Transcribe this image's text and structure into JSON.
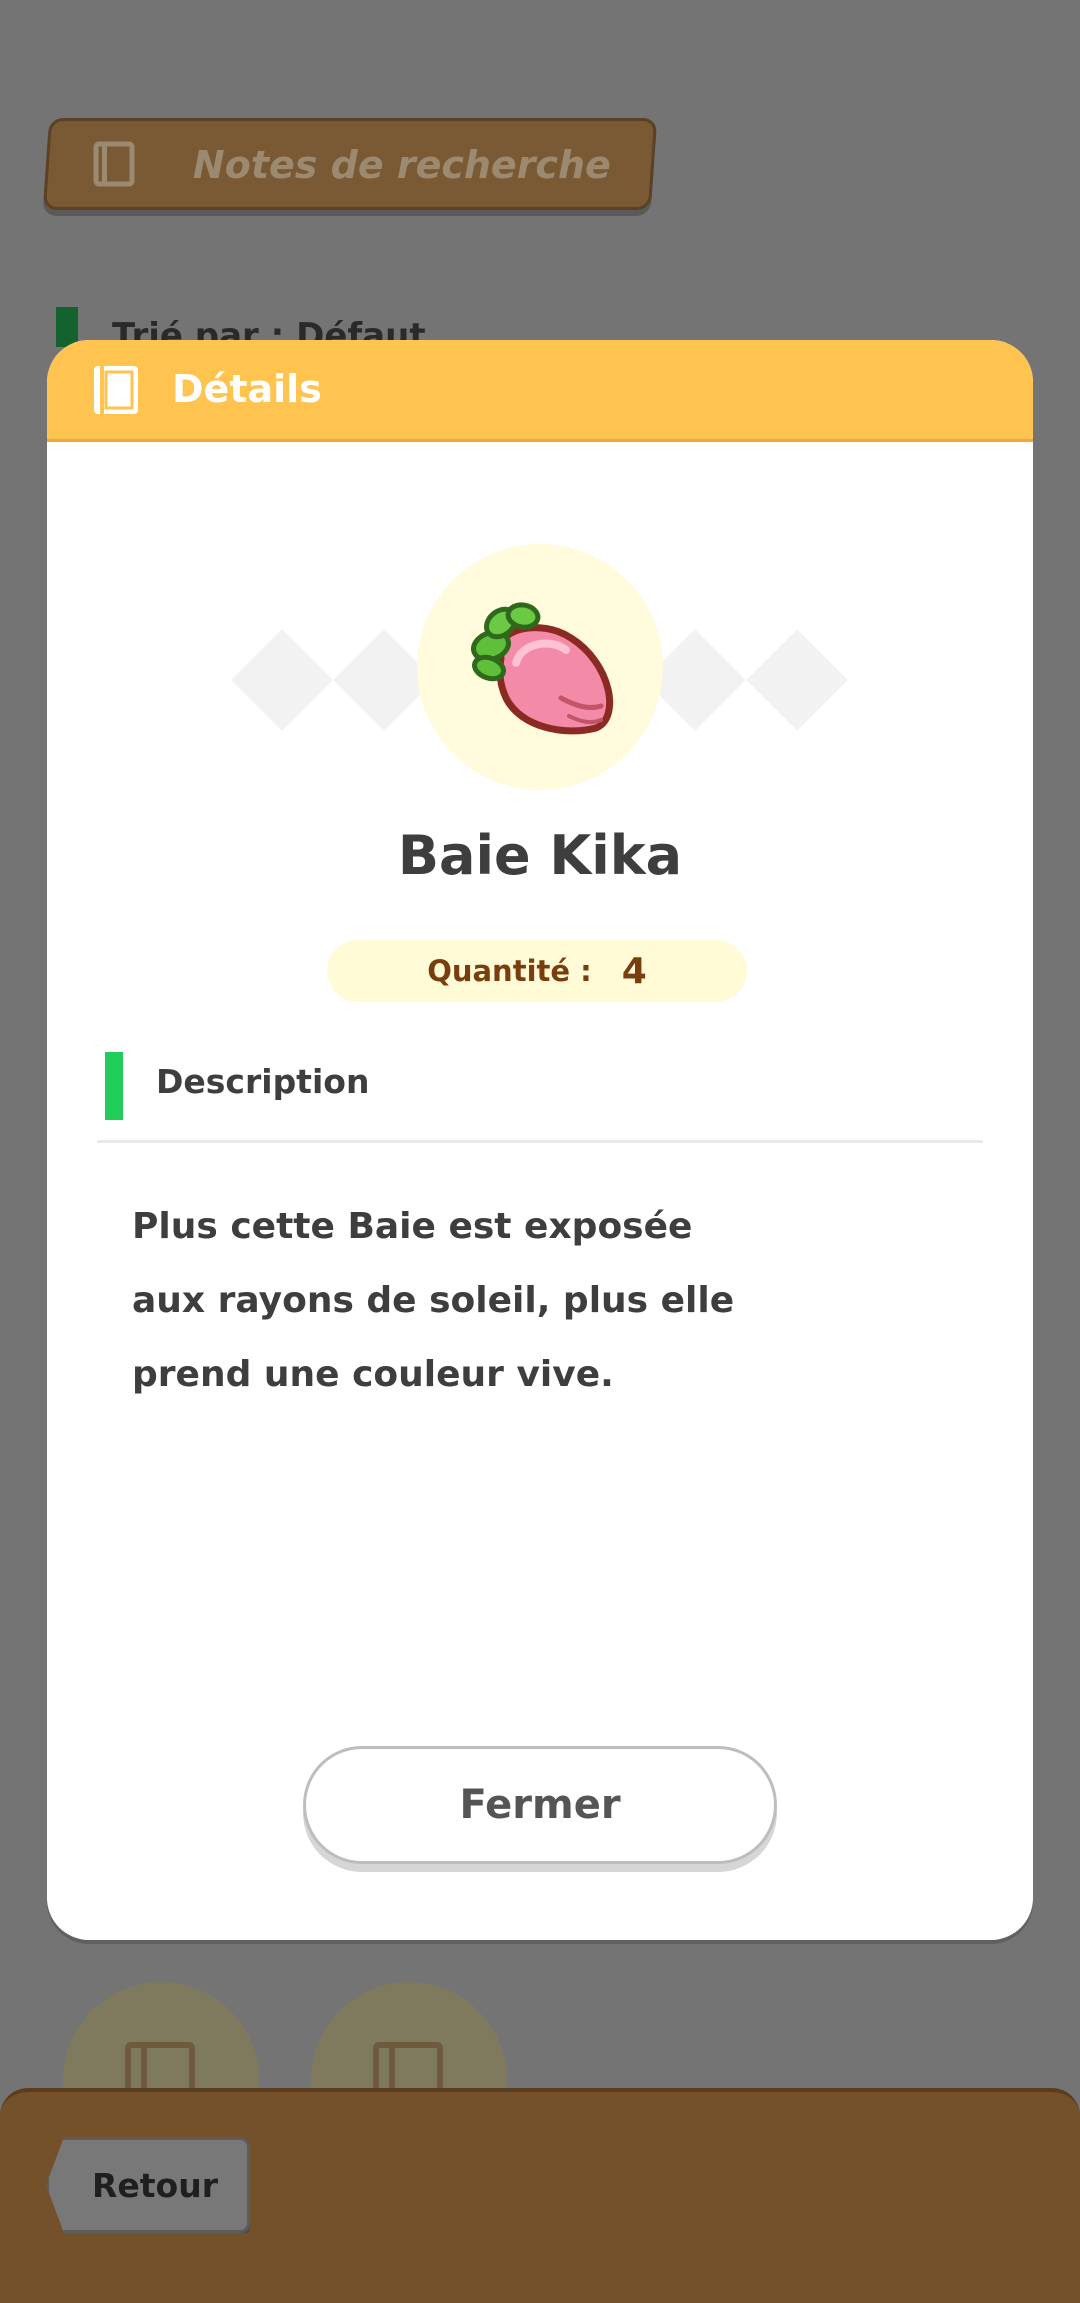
{
  "background": {
    "research_tab": {
      "label": "Notes de recherche",
      "icon": "notebook-icon"
    },
    "sort_label": "Trié par : Défaut",
    "back_button_label": "Retour"
  },
  "modal": {
    "title": "Détails",
    "title_icon": "notebook-icon",
    "item": {
      "name": "Baie Kika",
      "icon": "pink-berry-icon",
      "quantity_label": "Quantité :",
      "quantity_value": "4"
    },
    "description_heading": "Description",
    "description_text": "Plus cette Baie est exposée aux rayons de soleil, plus elle prend une couleur vive.",
    "close_button_label": "Fermer"
  },
  "colors": {
    "overlay": "#747474",
    "header": "#ffc350",
    "accent_green": "#22cc5a",
    "quantity_text": "#7a3d0e",
    "footer": "#74502b"
  }
}
